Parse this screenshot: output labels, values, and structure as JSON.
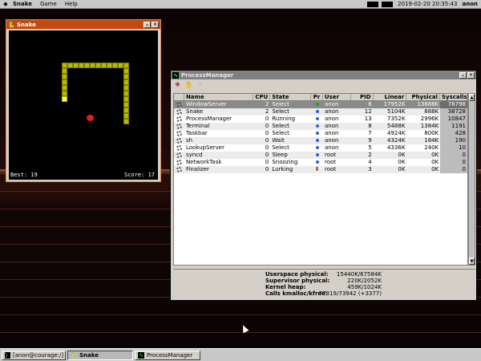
{
  "menubar": {
    "system_icon": "serenity-logo-icon",
    "app_menu": "Snake",
    "menus": [
      "Game",
      "Help"
    ],
    "clock": "2019-02-20 20:35:43",
    "user": "anon"
  },
  "snake": {
    "title": "Snake",
    "best_label": "Best: 19",
    "score_label": "Score: 17",
    "colors": {
      "body": "#b8b800",
      "head": "#ffff30",
      "apple": "#e02010",
      "background": "#000000"
    }
  },
  "process_manager": {
    "title": "ProcessManager",
    "toolbar": [
      {
        "name": "kill",
        "icon": "kill-icon"
      },
      {
        "name": "stop",
        "icon": "stop-hand-icon"
      },
      {
        "name": "continue",
        "icon": "continue-hand-icon"
      }
    ],
    "columns": [
      "Name",
      "CPU",
      "State",
      "Pr",
      "User",
      "PID",
      "Linear",
      "Physical",
      "Syscalls"
    ],
    "rows": [
      {
        "name": "WindowServer",
        "cpu": "2",
        "state": "Select",
        "pr": "green",
        "user": "anon",
        "pid": "6",
        "linear": "17952K",
        "physical": "13888K",
        "syscalls": "78798"
      },
      {
        "name": "Snake",
        "cpu": "2",
        "state": "Select",
        "pr": "blue",
        "user": "anon",
        "pid": "12",
        "linear": "5104K",
        "physical": "888K",
        "syscalls": "38728"
      },
      {
        "name": "ProcessManager",
        "cpu": "0",
        "state": "Running",
        "pr": "blue",
        "user": "anon",
        "pid": "13",
        "linear": "7352K",
        "physical": "2996K",
        "syscalls": "10847"
      },
      {
        "name": "Terminal",
        "cpu": "0",
        "state": "Select",
        "pr": "blue",
        "user": "anon",
        "pid": "8",
        "linear": "5488K",
        "physical": "1384K",
        "syscalls": "1191"
      },
      {
        "name": "Taskbar",
        "cpu": "0",
        "state": "Select",
        "pr": "blue",
        "user": "anon",
        "pid": "7",
        "linear": "4924K",
        "physical": "800K",
        "syscalls": "428"
      },
      {
        "name": "sh",
        "cpu": "0",
        "state": "Wait",
        "pr": "blue",
        "user": "anon",
        "pid": "9",
        "linear": "4324K",
        "physical": "184K",
        "syscalls": "190"
      },
      {
        "name": "LookupServer",
        "cpu": "0",
        "state": "Select",
        "pr": "blue",
        "user": "anon",
        "pid": "5",
        "linear": "4336K",
        "physical": "240K",
        "syscalls": "10"
      },
      {
        "name": "syncd",
        "cpu": "0",
        "state": "Sleep",
        "pr": "blue",
        "user": "root",
        "pid": "2",
        "linear": "0K",
        "physical": "0K",
        "syscalls": "0"
      },
      {
        "name": "NetworkTask",
        "cpu": "0",
        "state": "Snoozing",
        "pr": "blue",
        "user": "root",
        "pid": "4",
        "linear": "0K",
        "physical": "0K",
        "syscalls": "0"
      },
      {
        "name": "Finalizer",
        "cpu": "0",
        "state": "Lurking",
        "pr": "down",
        "user": "root",
        "pid": "3",
        "linear": "0K",
        "physical": "0K",
        "syscalls": "0"
      }
    ],
    "stats": [
      {
        "label": "Userspace physical:",
        "value": "15440K/67584K"
      },
      {
        "label": "Supervisor physical:",
        "value": "220K/2052K"
      },
      {
        "label": "Kernel heap:",
        "value": "459K/1024K"
      },
      {
        "label": "Calls kmalloc/kfree:",
        "value": "77319/73942 (+3377)"
      }
    ]
  },
  "taskbar": {
    "items": [
      {
        "label": "[anon@courage:/]",
        "icon": "terminal-icon"
      },
      {
        "label": "Snake",
        "icon": "snake-icon"
      },
      {
        "label": "ProcessManager",
        "icon": "process-manager-icon"
      }
    ]
  }
}
